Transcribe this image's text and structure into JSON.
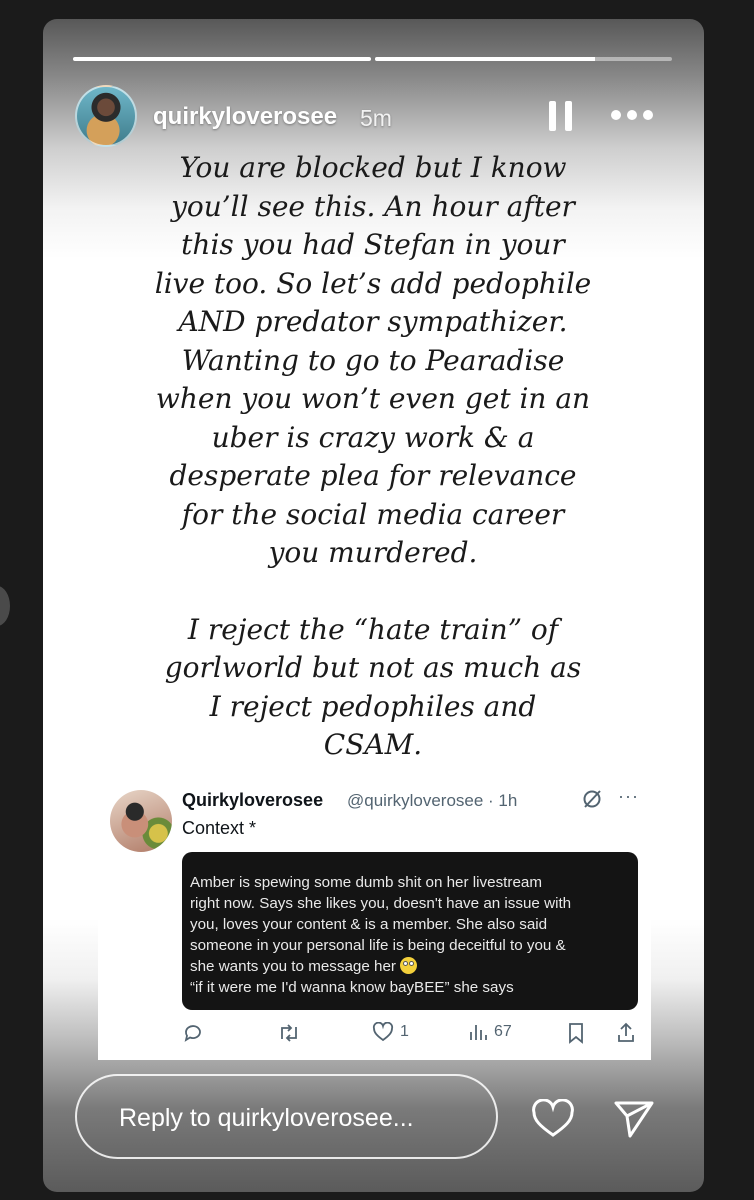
{
  "story": {
    "progress": [
      1.0,
      0.74
    ],
    "header": {
      "username": "quirkyloverosee",
      "time": "5m",
      "pause_icon": "pause-icon",
      "more_icon": "more-horizontal-icon"
    },
    "text_lines": [
      "You are blocked but I know",
      "you’ll see this. An hour after",
      "this you had Stefan in your",
      "live too. So let’s add pedophile",
      "AND predator sympathizer.",
      "Wanting to go to Pearadise",
      "when you won’t even get in an",
      "uber is crazy work & a",
      "desperate plea for relevance",
      "for the social media career",
      "you murdered."
    ],
    "text_lines_2": [
      "I reject the “hate train” of",
      "gorlworld but not as much as",
      "I reject pedophiles and",
      "CSAM."
    ]
  },
  "tweet": {
    "name": "Quirkyloverosee",
    "handle": "@quirkyloverosee · 1h",
    "context": "Context *",
    "image_lines": [
      "Amber is spewing some dumb shit on her livestream",
      "right now. Says she likes you, doesn't have an issue with",
      "you, loves your content & is a member. She also said",
      "someone in your personal life is being deceitful to you &",
      "she wants you to message her",
      "“if it were me I'd wanna know bayBEE” she says"
    ],
    "likes": "1",
    "views": "67",
    "icons": [
      "reply-icon",
      "retweet-icon",
      "like-icon",
      "views-icon",
      "bookmark-icon",
      "share-icon"
    ]
  },
  "reply": {
    "placeholder": "Reply to quirkyloverosee...",
    "heart_icon": "heart-icon",
    "send_icon": "send-icon"
  }
}
